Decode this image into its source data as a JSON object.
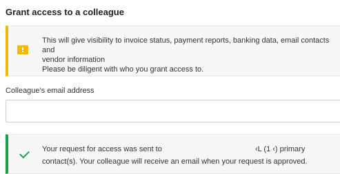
{
  "title": "Grant access to a colleague",
  "warning": {
    "icon": "warning-icon",
    "line1": "This will give visibility to invoice status, payment reports, banking data, email contacts and",
    "line2": "vendor information",
    "line3": "Please be diligent with who you grant access to.",
    "accent": "#f5b800"
  },
  "email_field": {
    "label": "Colleague's email address",
    "value": "",
    "placeholder": ""
  },
  "success": {
    "icon": "checkmark-icon",
    "line1_left": "Your request for access was sent to",
    "line1_right": "‹L (1        ‹) primary",
    "line2": "contact(s). Your colleague will receive an email when your request is approved.",
    "accent": "#16a34a"
  }
}
